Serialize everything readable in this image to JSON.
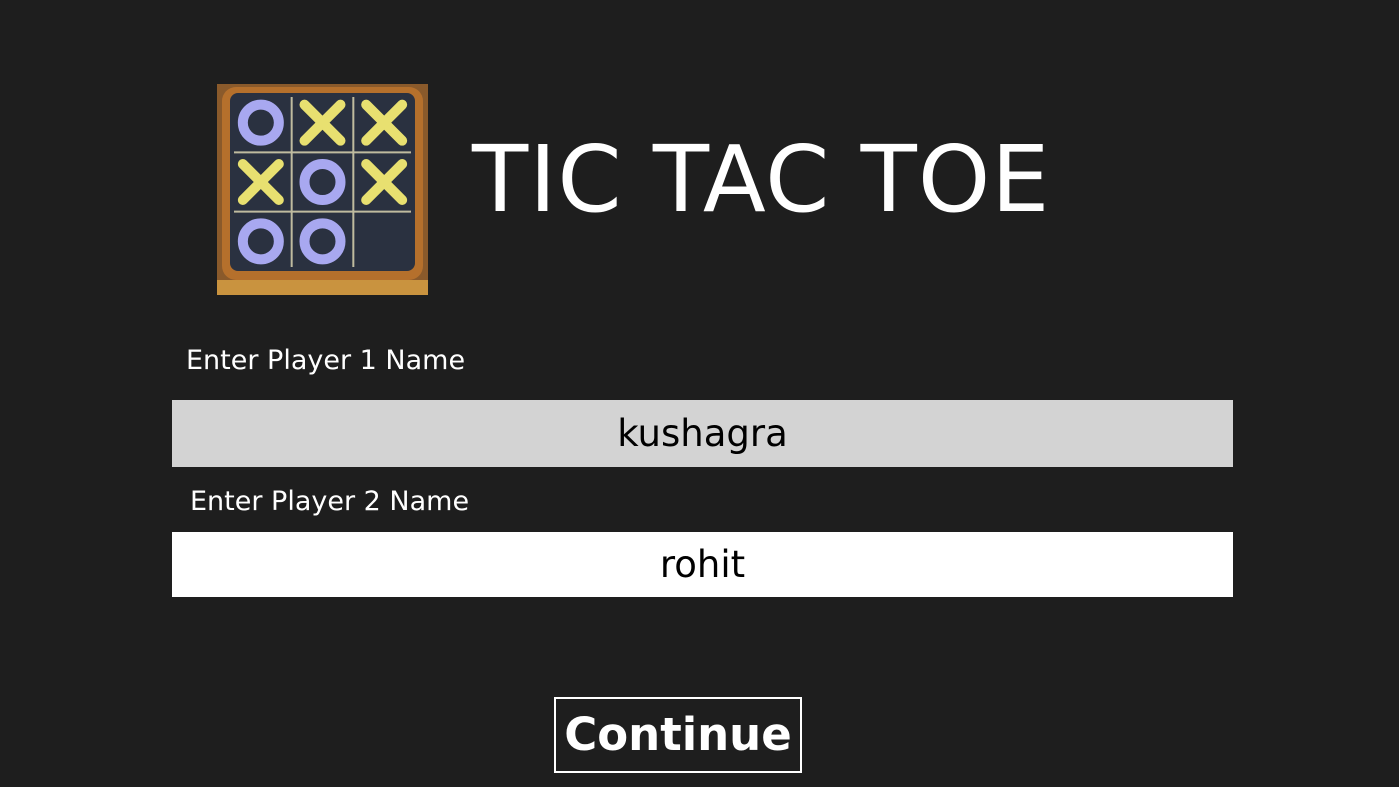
{
  "app": {
    "title": "TIC TAC TOE",
    "logo_icon": "tic-tac-toe-board-icon"
  },
  "form": {
    "player1": {
      "label": "Enter Player 1 Name",
      "value": "kushagra"
    },
    "player2": {
      "label": "Enter Player 2 Name",
      "value": "rohit"
    },
    "continue_label": "Continue"
  },
  "logo_board": {
    "cells": [
      "O",
      "X",
      "X",
      "X",
      "O",
      "X",
      "O",
      "O",
      ""
    ]
  },
  "colors": {
    "background": "#1e1e1e",
    "input_active_bg": "#d3d3d3",
    "input_bg": "#ffffff",
    "text": "#ffffff",
    "o_mark": "#a8a8f0",
    "x_mark": "#e8e070",
    "board_frame": "#b5702c",
    "board_surface": "#2a3140"
  }
}
